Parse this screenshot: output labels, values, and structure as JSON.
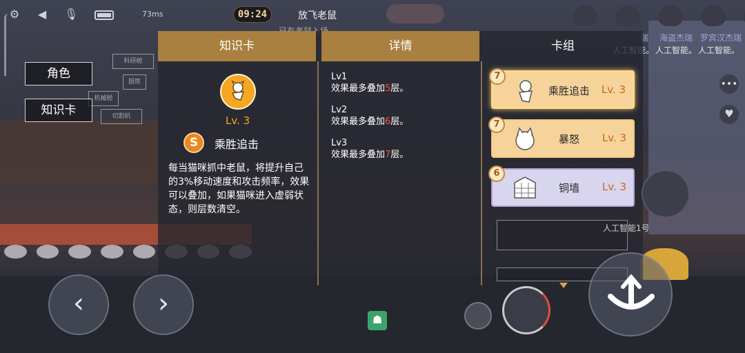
{
  "status": {
    "ping": "73ms",
    "timer": "09:24",
    "mode_title": "放飞老鼠",
    "mode_sub": "已有老鼠入场"
  },
  "chat": {
    "names": [
      "瑞",
      "海盗杰瑞",
      "罗宾汉杰瑞"
    ],
    "messages": [
      "人工智能。",
      "人工智能。",
      "人工智能。"
    ]
  },
  "side_tabs": {
    "role": "角色",
    "knowledge": "知识卡"
  },
  "minimap": {
    "rooms": [
      "",
      "科研舱",
      "",
      "",
      "厨房",
      "",
      "机械舱",
      "",
      "",
      "储藏",
      "",
      "",
      "切割机",
      ""
    ]
  },
  "columns": {
    "card": "知识卡",
    "detail": "详情",
    "deck": "卡组"
  },
  "card": {
    "level": "Lv. 3",
    "grade": "S",
    "name": "乘胜追击",
    "description": "每当猫咪抓中老鼠，将提升自己的3%移动速度和攻击频率，效果可以叠加，如果猫咪进入虚弱状态，则层数清空。"
  },
  "details": [
    {
      "level": "Lv1",
      "prefix": "效果最多叠加",
      "count": "5",
      "suffix": "层。"
    },
    {
      "level": "Lv2",
      "prefix": "效果最多叠加",
      "count": "6",
      "suffix": "层。"
    },
    {
      "level": "Lv3",
      "prefix": "效果最多叠加",
      "count": "7",
      "suffix": "层。"
    }
  ],
  "deck": [
    {
      "cost": "7",
      "name": "乘胜追击",
      "level": "Lv. 3"
    },
    {
      "cost": "7",
      "name": "暴怒",
      "level": "Lv. 3"
    },
    {
      "cost": "6",
      "name": "铜墙",
      "level": "Lv. 3"
    }
  ],
  "hud": {
    "player_label": "人工智能1号",
    "left_arrow": "‹",
    "right_arrow": "›"
  },
  "colors": {
    "accent_gold": "#a9803f",
    "card_orange": "#f5a623",
    "highlight_red": "#ff4d4d",
    "deck_card": "#f6d39a",
    "deck_card_purple": "#d8d5ee"
  },
  "icons": {
    "settings": "gear-icon",
    "volume": "speaker-icon",
    "mic": "mic-muted-icon",
    "battery": "battery-icon",
    "chat": "chat-bubble-icon",
    "emote": "heart-icon",
    "jump": "jump-icon",
    "ghost": "ghost-icon"
  }
}
